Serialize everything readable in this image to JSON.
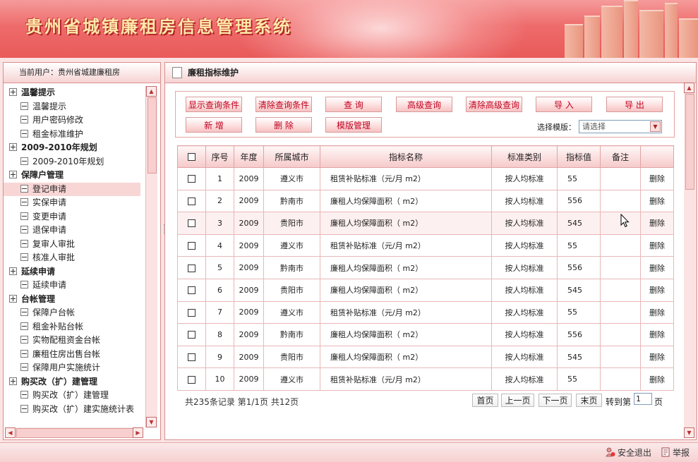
{
  "app": {
    "title": "贵州省城镇廉租房信息管理系统"
  },
  "sidebar": {
    "current_user": "当前用户：贵州省城建廉租房",
    "groups": [
      {
        "label": "温馨提示",
        "items": [
          "温馨提示",
          "用户密码修改",
          "租金标准维护"
        ]
      },
      {
        "label": "2009-2010年规划",
        "items": [
          "2009-2010年规划"
        ]
      },
      {
        "label": "保障户管理",
        "items": [
          "登记申请",
          "实保申请",
          "变更申请",
          "退保申请",
          "复审人审批",
          "核准人审批"
        ]
      },
      {
        "label": "延续申请",
        "items": [
          "延续申请"
        ]
      },
      {
        "label": "台帐管理",
        "items": [
          "保障户台帐",
          "租金补贴台帐",
          "实物配租资金台帐",
          "廉租住房出售台帐",
          "保障用户实施统计"
        ]
      },
      {
        "label": "购买改（扩）建管理",
        "items": [
          "购买改（扩）建管理",
          "购买改（扩）建实施统计表"
        ]
      }
    ],
    "selected_item": "登记申请"
  },
  "panel": {
    "title": "廉租指标维护"
  },
  "toolbar": {
    "show_query": "显示查询条件",
    "clear_query": "清除查询条件",
    "query": "查  询",
    "advanced_query": "高级查询",
    "clear_advanced_query": "清除高级查询",
    "import": "导  入",
    "export": "导  出",
    "add": "新  增",
    "delete": "删  除",
    "template_manage": "模版管理",
    "template_label": "选择模版：",
    "template_select": "请选择"
  },
  "table": {
    "columns": [
      "序号",
      "年度",
      "所属城市",
      "指标名称",
      "标准类别",
      "指标值",
      "备注",
      ""
    ],
    "action_label": "删除",
    "rows": [
      {
        "no": "1",
        "year": "2009",
        "city": "遵义市",
        "name": "租赁补贴标准（元/月 m2）",
        "category": "按人均标准",
        "value": "55",
        "note": ""
      },
      {
        "no": "2",
        "year": "2009",
        "city": "黔南市",
        "name": "廉租人均保障面积（ m2）",
        "category": "按人均标准",
        "value": "556",
        "note": ""
      },
      {
        "no": "3",
        "year": "2009",
        "city": "贵阳市",
        "name": "廉租人均保障面积（ m2）",
        "category": "按人均标准",
        "value": "545",
        "note": ""
      },
      {
        "no": "4",
        "year": "2009",
        "city": "遵义市",
        "name": "租赁补贴标准（元/月 m2）",
        "category": "按人均标准",
        "value": "55",
        "note": ""
      },
      {
        "no": "5",
        "year": "2009",
        "city": "黔南市",
        "name": "廉租人均保障面积（ m2）",
        "category": "按人均标准",
        "value": "556",
        "note": ""
      },
      {
        "no": "6",
        "year": "2009",
        "city": "贵阳市",
        "name": "廉租人均保障面积（ m2）",
        "category": "按人均标准",
        "value": "545",
        "note": ""
      },
      {
        "no": "7",
        "year": "2009",
        "city": "遵义市",
        "name": "租赁补贴标准（元/月 m2）",
        "category": "按人均标准",
        "value": "55",
        "note": ""
      },
      {
        "no": "8",
        "year": "2009",
        "city": "黔南市",
        "name": "廉租人均保障面积（ m2）",
        "category": "按人均标准",
        "value": "556",
        "note": ""
      },
      {
        "no": "9",
        "year": "2009",
        "city": "贵阳市",
        "name": "廉租人均保障面积（ m2）",
        "category": "按人均标准",
        "value": "545",
        "note": ""
      },
      {
        "no": "10",
        "year": "2009",
        "city": "遵义市",
        "name": "租赁补贴标准（元/月 m2）",
        "category": "按人均标准",
        "value": "55",
        "note": ""
      }
    ],
    "highlighted_row": 3
  },
  "pager": {
    "summary": "共235条记录  第1/1页  共12页",
    "first": "首页",
    "prev": "上一页",
    "next": "下一页",
    "last": "末页",
    "jump_label": "转到第",
    "jump_value": "1",
    "jump_suffix": "页"
  },
  "footer": {
    "logout": "安全退出",
    "report": "举报"
  },
  "colors": {
    "accent": "#e95a5a",
    "button_text": "#c0001e",
    "border": "#d98e8e"
  }
}
